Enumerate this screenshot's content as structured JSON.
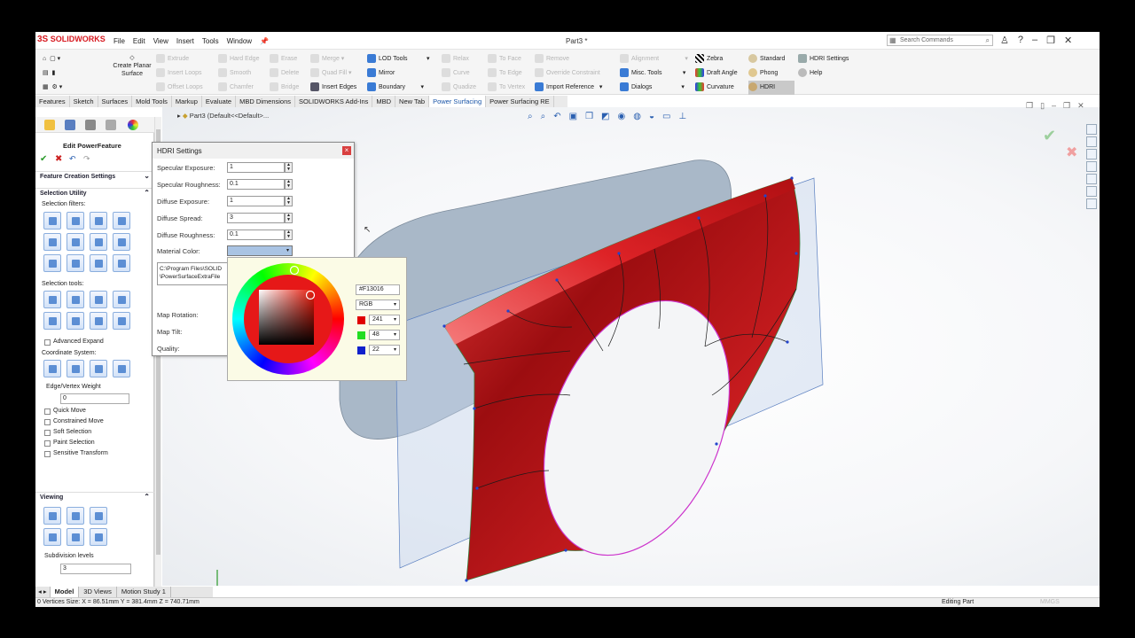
{
  "app": {
    "brand": "SOLIDWORKS",
    "title": "Part3 *",
    "search_placeholder": "Search Commands"
  },
  "menu": [
    "File",
    "Edit",
    "View",
    "Insert",
    "Tools",
    "Window"
  ],
  "command_manager": {
    "create_planar": "Create Planar Surface",
    "col1": [
      "Extrude",
      "Insert Loops",
      "Offset Loops"
    ],
    "col2": [
      "Hard Edge",
      "Smooth",
      "Chamfer"
    ],
    "col3": [
      "Erase",
      "Delete",
      "Bridge"
    ],
    "col4": [
      "Merge",
      "Quad Fill",
      "Insert Edges"
    ],
    "col5": [
      "LOD Tools",
      "Mirror",
      "Boundary"
    ],
    "col6": [
      "Relax",
      "Curve",
      "Quadize"
    ],
    "col7": [
      "To Face",
      "To Edge",
      "To Vertex"
    ],
    "col8": [
      "Remove",
      "Override Constraint",
      "Import Reference"
    ],
    "col9": [
      "Alignment",
      "Misc. Tools",
      "Dialogs"
    ],
    "col10": [
      "Zebra",
      "Draft Angle",
      "Curvature"
    ],
    "col11": [
      "Standard",
      "Phong",
      "HDRI"
    ],
    "col12": [
      "HDRI Settings",
      "Help"
    ]
  },
  "tabs": [
    "Features",
    "Sketch",
    "Surfaces",
    "Mold Tools",
    "Markup",
    "Evaluate",
    "MBD Dimensions",
    "SOLIDWORKS Add-Ins",
    "MBD",
    "New Tab",
    "Power Surfacing",
    "Power Surfacing RE"
  ],
  "feature_path": "Part3  (Default<<Default>...",
  "property_manager": {
    "title": "Edit PowerFeature",
    "feature_settings": "Feature Creation Settings",
    "selection_utility": "Selection Utility",
    "selection_filters": "Selection filters:",
    "selection_tools": "Selection tools:",
    "advanced_expand": "Advanced Expand",
    "coordinate_system": "Coordinate System:",
    "edge_vertex_weight": "Edge/Vertex Weight",
    "weight_value": "0",
    "checkboxes": [
      "Quick Move",
      "Constrained Move",
      "Soft Selection",
      "Paint Selection",
      "Sensitive Transform"
    ],
    "viewing": "Viewing",
    "subdivision_levels": "Subdivision levels",
    "subdivision_value": "3"
  },
  "hdri_dialog": {
    "title": "HDRI Settings",
    "fields": [
      {
        "label": "Specular Exposure:",
        "value": "1"
      },
      {
        "label": "Specular Roughness:",
        "value": "0.1"
      },
      {
        "label": "Diffuse Exposure:",
        "value": "1"
      },
      {
        "label": "Diffuse Spread:",
        "value": "3"
      },
      {
        "label": "Diffuse Roughness:",
        "value": "0.1"
      }
    ],
    "material_color": "Material Color:",
    "path_line1": "C:\\Program Files\\SOLID",
    "path_line2": "\\PowerSurfaceExtraFile",
    "map_rotation": "Map Rotation:",
    "map_tilt": "Map Tilt:",
    "quality": "Quality:"
  },
  "color_picker": {
    "hex": "#F13016",
    "mode": "RGB",
    "r": "241",
    "g": "48",
    "b": "22",
    "color": "#F13016"
  },
  "bottom_tabs": [
    "Model",
    "3D Views",
    "Motion Study 1"
  ],
  "status": {
    "left": "0 Vertices  Size: X = 86.51mm Y = 381.4mm Z = 740.71mm",
    "right": "Editing Part",
    "unit": "MMGS"
  }
}
